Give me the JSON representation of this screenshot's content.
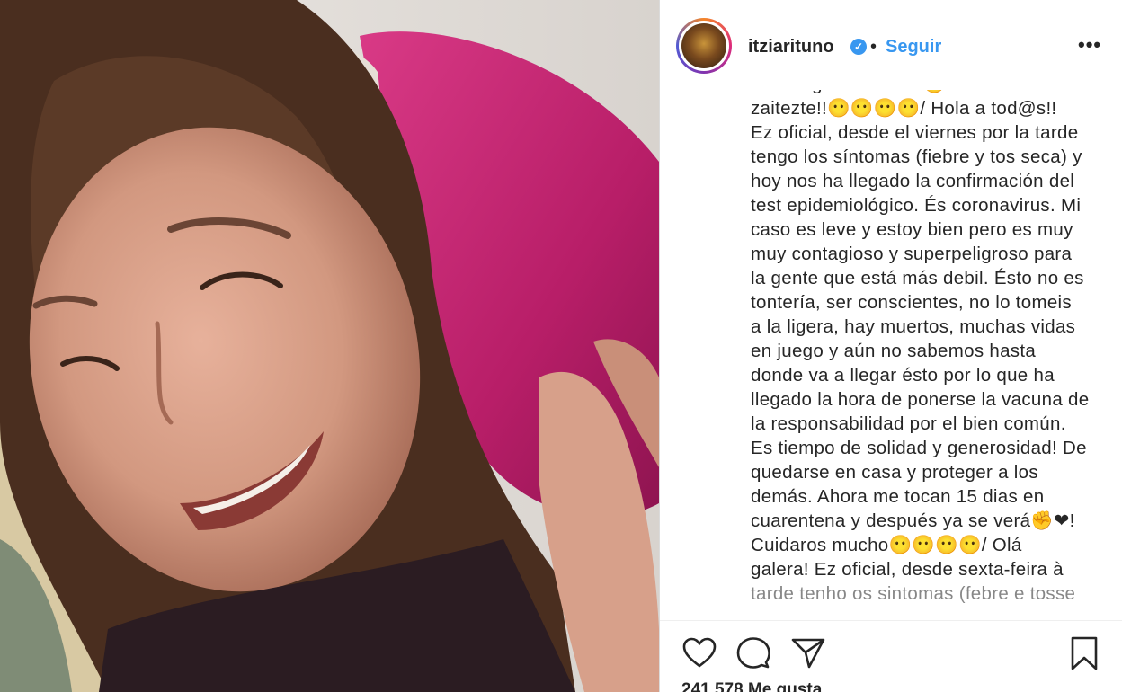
{
  "post": {
    "username": "itziarituno",
    "follow_label": "Seguir",
    "dot": "•",
    "verified_mark": "✓",
    "more_label": "•••",
    "likes_text": "241.578 Me gusta"
  },
  "caption_lines": [
    "aurrerago ikusiko da🙂❤.Zaindu",
    "zaitezte!!😶😶😶😶/ Hola a tod@s!!",
    "Ez oficial, desde el viernes por la tarde",
    "tengo los síntomas (fiebre y tos seca) y",
    "hoy nos ha llegado la confirmación del",
    "test epidemiológico. És coronavirus. Mi",
    "caso es leve y estoy bien pero es muy",
    "muy contagioso y superpeligroso para",
    "la gente que está más debil. Ésto no es",
    "tontería, ser conscientes, no lo tomeis",
    "a la ligera, hay muertos, muchas vidas",
    "en juego y aún no sabemos hasta",
    "donde va a llegar ésto por lo que ha",
    "llegado la hora de ponerse la vacuna de",
    "la responsabilidad por el bien común.",
    "Es tiempo de solidad y generosidad! De",
    "quedarse en casa y proteger a los",
    "demás. Ahora me tocan 15 dias en",
    "cuarentena y después ya se verá✊❤!",
    "Cuidaros mucho😶😶😶😶/ Olá",
    "galera! Ez oficial, desde sexta-feira à",
    "tarde tenho os sintomas (febre e tosse"
  ],
  "icons": {
    "like": "heart-icon",
    "comment": "comment-bubble-icon",
    "share": "paper-plane-icon",
    "save": "bookmark-icon",
    "verified": "verified-badge-icon",
    "more": "more-options-icon"
  },
  "colors": {
    "accent_blue": "#3897f0",
    "text": "#262626",
    "pillow_pink": "#c2286f"
  }
}
